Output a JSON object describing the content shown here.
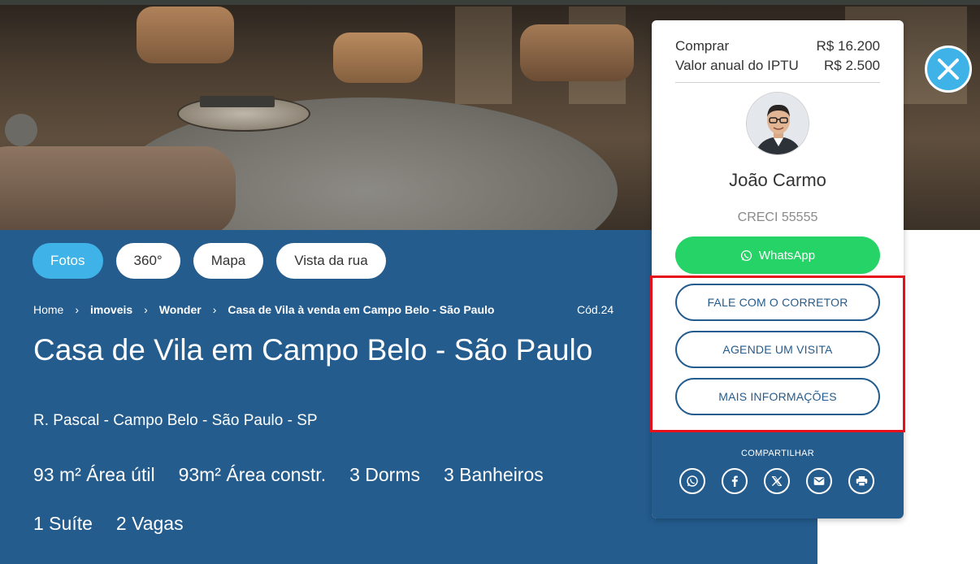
{
  "media_tabs": [
    {
      "label": "Fotos",
      "active": true
    },
    {
      "label": "360°",
      "active": false
    },
    {
      "label": "Mapa",
      "active": false
    },
    {
      "label": "Vista da rua",
      "active": false
    }
  ],
  "breadcrumb": [
    "Home",
    "imoveis",
    "Wonder",
    "Casa de Vila à venda em Campo Belo - São Paulo"
  ],
  "code": "Cód.24",
  "title": "Casa de Vila em Campo Belo - São Paulo",
  "address": "R. Pascal - Campo Belo - São Paulo - SP",
  "features": [
    "93 m² Área útil",
    "93m² Área constr.",
    "3 Dorms",
    "3 Banheiros",
    "1 Suíte",
    "2 Vagas"
  ],
  "card": {
    "prices": [
      {
        "label": "Comprar",
        "value": "R$ 16.200"
      },
      {
        "label": "Valor anual do IPTU",
        "value": "R$ 2.500"
      }
    ],
    "agent_name": "João Carmo",
    "creci": "CRECI 55555",
    "whatsapp_label": "WhatsApp",
    "contact_label": "FALE COM O CORRETOR",
    "visit_label": "AGENDE UM VISITA",
    "info_label": "MAIS INFORMAÇÕES",
    "share_label": "COMPARTILHAR"
  },
  "colors": {
    "primary_blue": "#245c8e",
    "accent_light_blue": "#3fb3e8",
    "whatsapp_green": "#25d366",
    "highlight_red": "#e6101a"
  },
  "icons": [
    "close-icon",
    "whatsapp-icon",
    "facebook-icon",
    "x-icon",
    "email-icon",
    "print-icon",
    "chevron-right-icon"
  ]
}
